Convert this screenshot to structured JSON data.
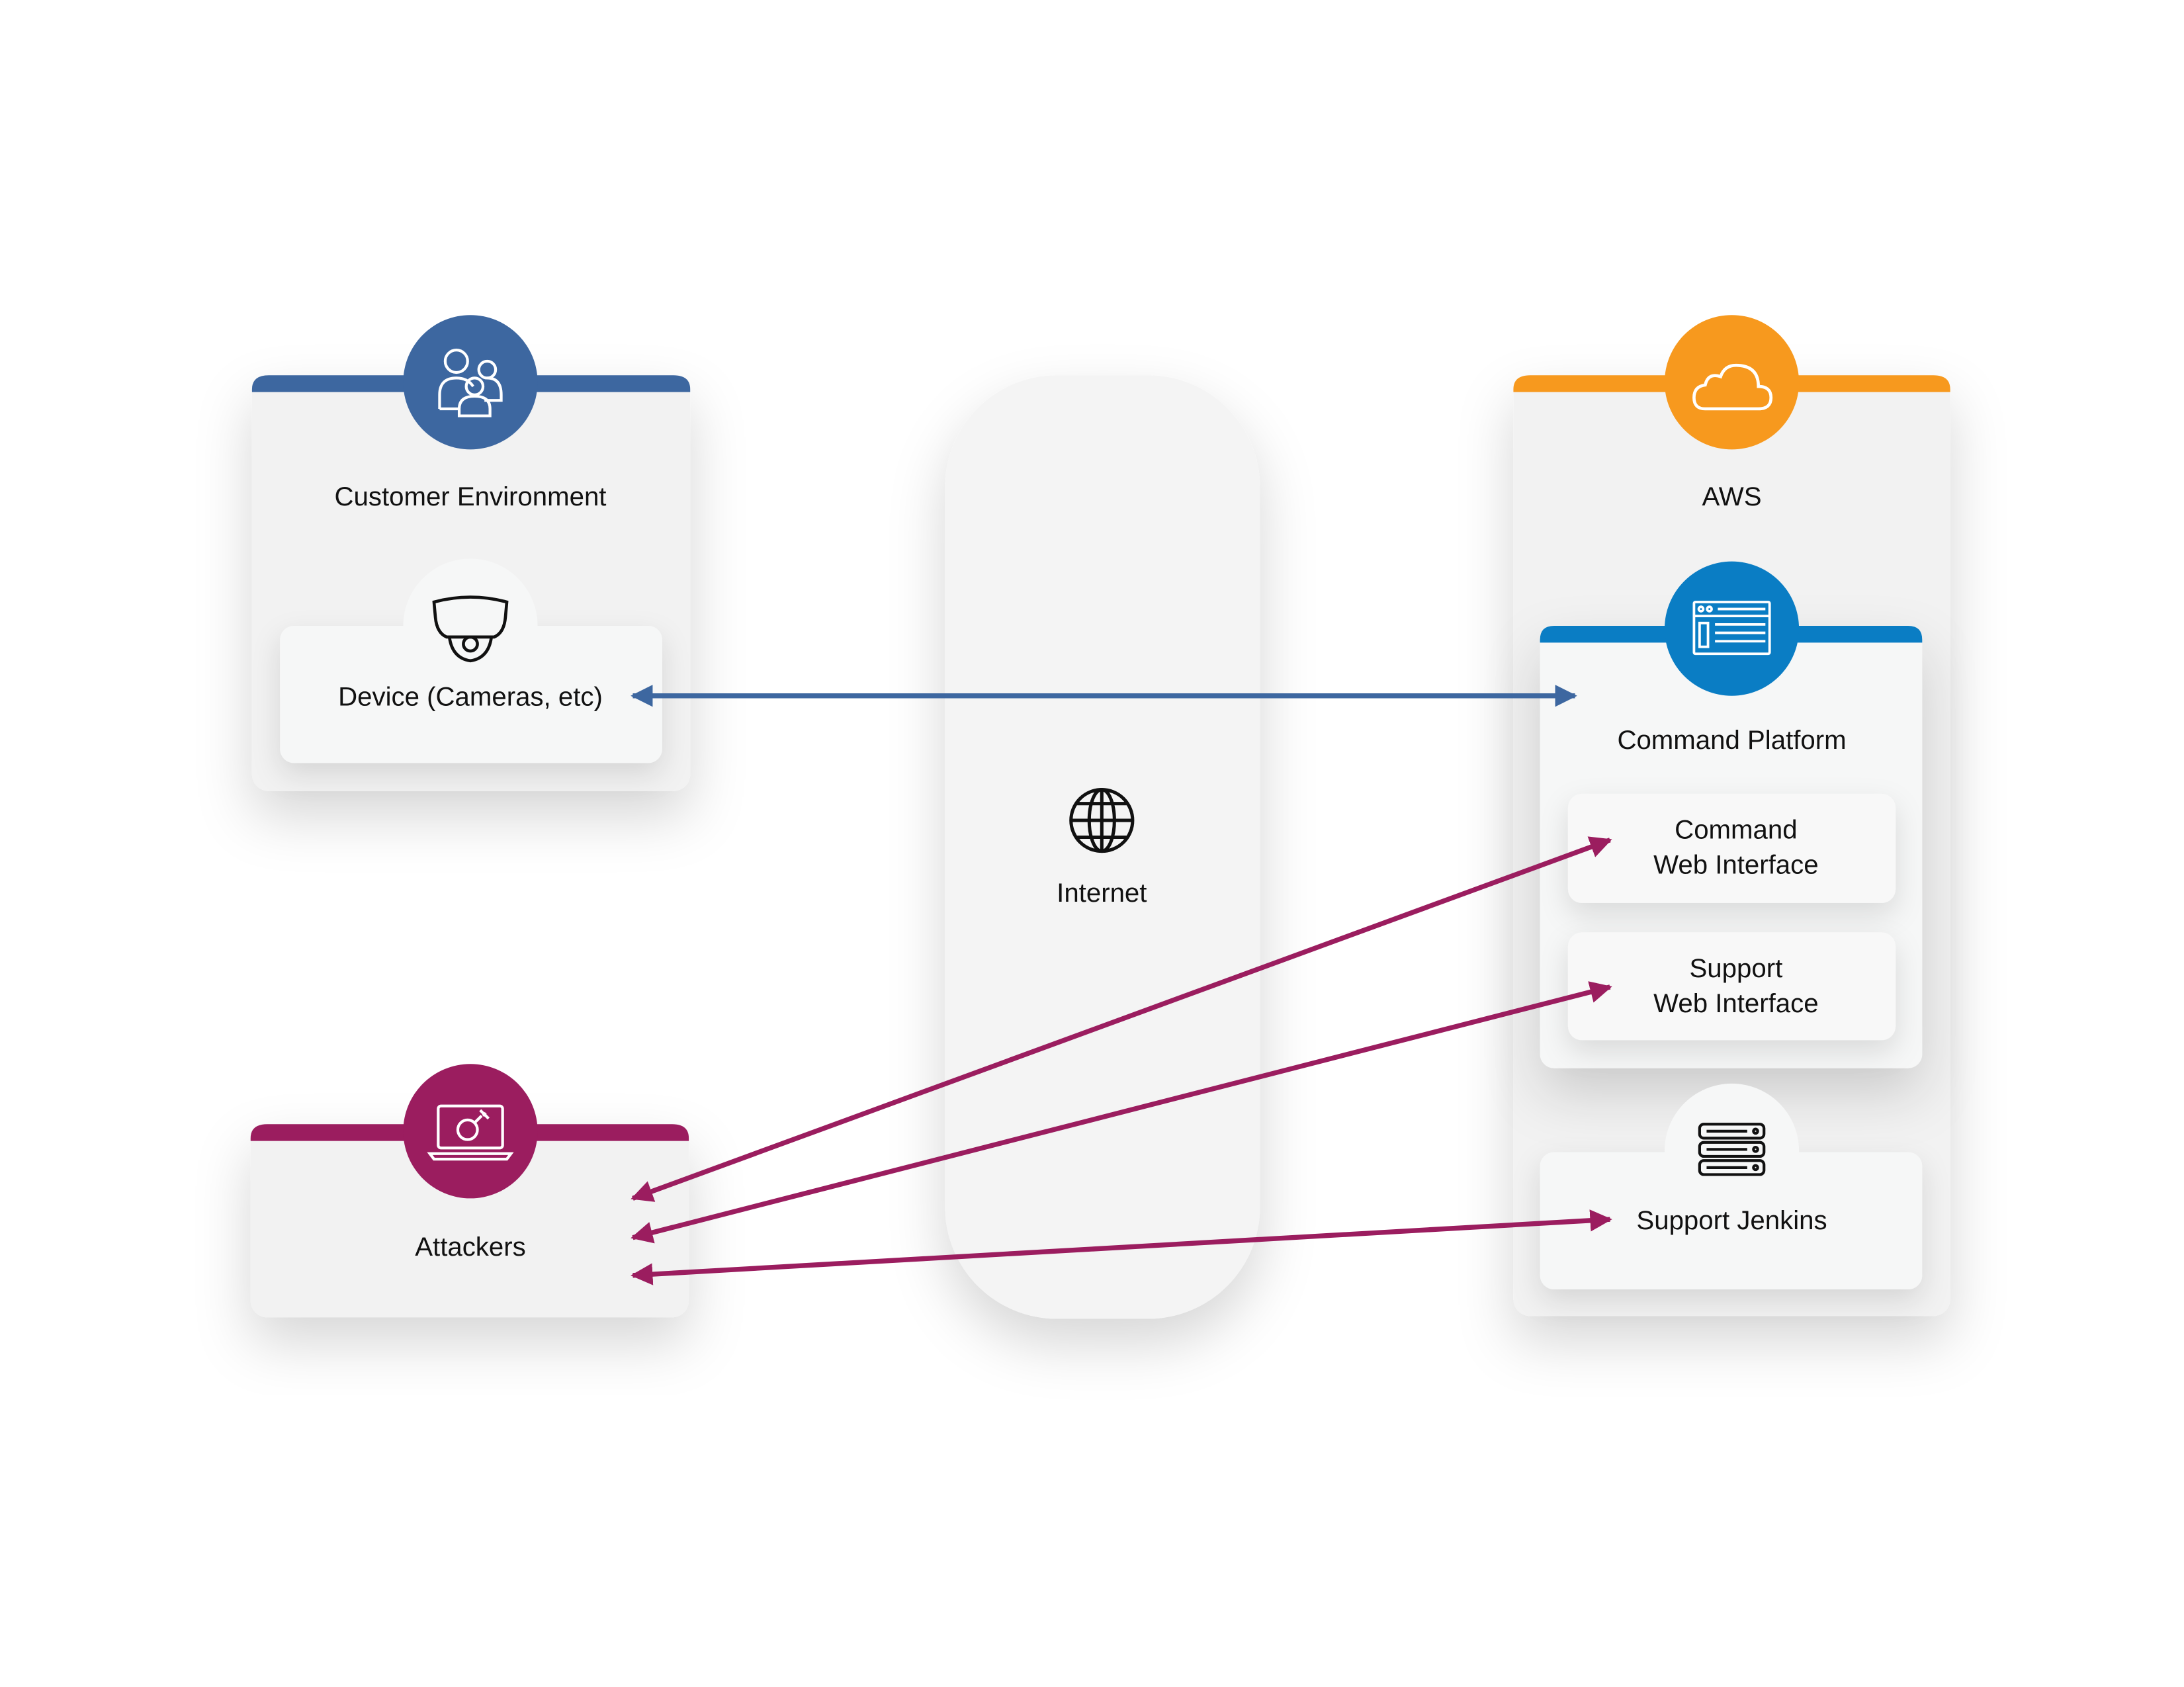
{
  "colors": {
    "customer": "#3D67A0",
    "aws": "#F7991E",
    "command_platform": "#0A7DC4",
    "attackers": "#9B1D5F",
    "panel": "#F2F2F2",
    "card": "#F6F7F7"
  },
  "customer_environment": {
    "title": "Customer Environment",
    "icon": "people-group-icon",
    "device": {
      "label": "Device (Cameras, etc)",
      "icon": "dome-camera-icon"
    }
  },
  "internet": {
    "label": "Internet",
    "icon": "globe-icon"
  },
  "aws": {
    "title": "AWS",
    "icon": "cloud-icon",
    "command_platform": {
      "title": "Command Platform",
      "icon": "browser-window-icon",
      "items": [
        {
          "line1": "Command",
          "line2": "Web Interface"
        },
        {
          "line1": "Support",
          "line2": "Web Interface"
        }
      ]
    },
    "jenkins": {
      "label": "Support Jenkins",
      "icon": "server-rack-icon"
    }
  },
  "attackers": {
    "title": "Attackers",
    "icon": "laptop-bomb-icon"
  },
  "connections": [
    {
      "from": "Device (Cameras, etc)",
      "to": "Command Platform",
      "direction": "bidirectional",
      "color": "#3D67A0"
    },
    {
      "from": "Attackers",
      "to": "Command Web Interface",
      "direction": "bidirectional",
      "color": "#9B1D5F"
    },
    {
      "from": "Attackers",
      "to": "Support Web Interface",
      "direction": "bidirectional",
      "color": "#9B1D5F"
    },
    {
      "from": "Attackers",
      "to": "Support Jenkins",
      "direction": "bidirectional",
      "color": "#9B1D5F"
    }
  ]
}
